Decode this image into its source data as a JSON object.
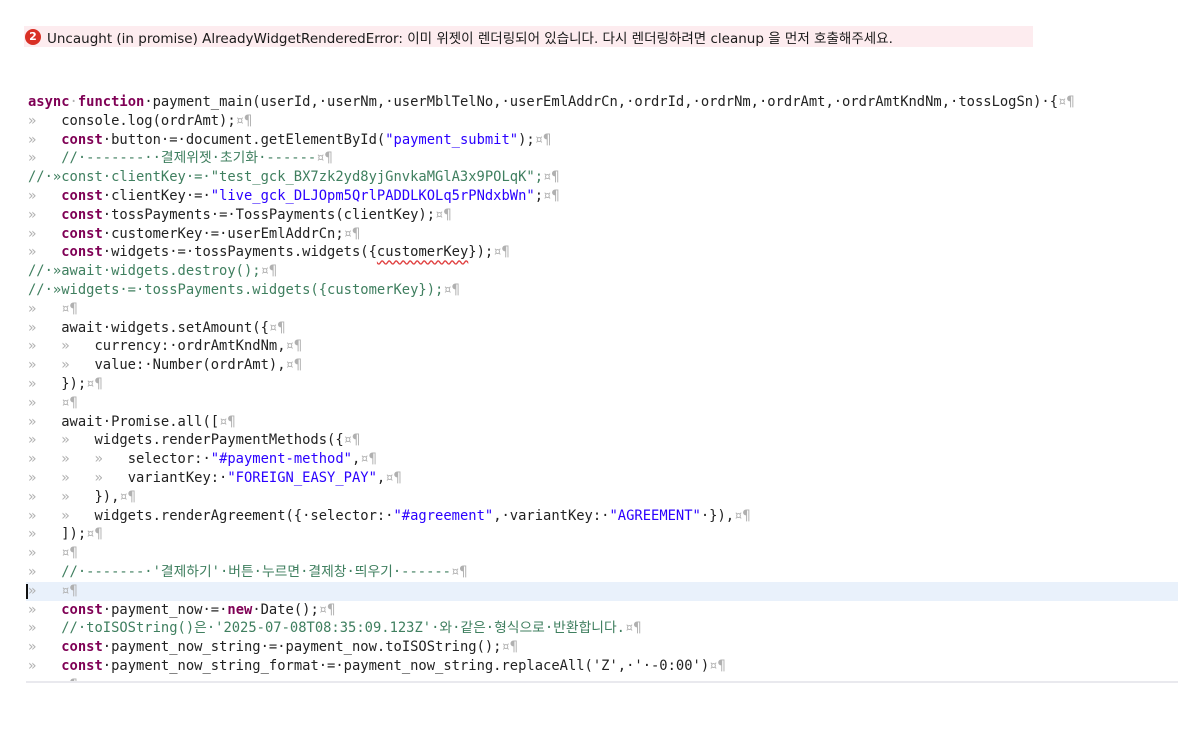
{
  "error_banner": {
    "icon_text": "2",
    "message": "Uncaught (in promise) AlreadyWidgetRenderedError: 이미 위젯이 렌더링되어 있습니다. 다시 렌더링하려면 cleanup 을 먼저 호출해주세요."
  },
  "editor": {
    "highlighted_line": 27,
    "lines": [
      [
        {
          "t": "async",
          "c": "kw"
        },
        {
          "t": "·",
          "c": "ws"
        },
        {
          "t": "function",
          "c": "kw"
        },
        {
          "t": "·payment_main(userId,·userNm,·userMblTelNo,·userEmlAddrCn,·ordrId,·ordrNm,·ordrAmt,·ordrAmtKndNm,·tossLogSn)·{"
        },
        {
          "t": "¤¶",
          "c": "ws"
        }
      ],
      [
        {
          "t": "»   ",
          "c": "ws"
        },
        {
          "t": "console.log(ordrAmt);"
        },
        {
          "t": "¤¶",
          "c": "ws"
        }
      ],
      [
        {
          "t": "»   ",
          "c": "ws"
        },
        {
          "t": "const",
          "c": "kw"
        },
        {
          "t": "·button·=·document.getElementById("
        },
        {
          "t": "\"payment_submit\"",
          "c": "str"
        },
        {
          "t": ");"
        },
        {
          "t": "¤¶",
          "c": "ws"
        }
      ],
      [
        {
          "t": "»   ",
          "c": "ws"
        },
        {
          "t": "//·-------··결제위젯·초기화·------",
          "c": "cm"
        },
        {
          "t": "¤¶",
          "c": "ws"
        }
      ],
      [
        {
          "t": "//·»const·clientKey·=·\"test_gck_BX7zk2yd8yjGnvkaMGlA3x9POLqK\";",
          "c": "cm"
        },
        {
          "t": "¤¶",
          "c": "ws"
        }
      ],
      [
        {
          "t": "»   ",
          "c": "ws"
        },
        {
          "t": "const",
          "c": "kw"
        },
        {
          "t": "·clientKey·=·"
        },
        {
          "t": "\"live_gck_DLJOpm5QrlPADDLKOLq5rPNdxbWn\"",
          "c": "str"
        },
        {
          "t": ";"
        },
        {
          "t": "¤¶",
          "c": "ws"
        }
      ],
      [
        {
          "t": "»   ",
          "c": "ws"
        },
        {
          "t": "const",
          "c": "kw"
        },
        {
          "t": "·tossPayments·=·TossPayments(clientKey);"
        },
        {
          "t": "¤¶",
          "c": "ws"
        }
      ],
      [
        {
          "t": "»   ",
          "c": "ws"
        },
        {
          "t": "const",
          "c": "kw"
        },
        {
          "t": "·customerKey·=·userEmlAddrCn;"
        },
        {
          "t": "¤¶",
          "c": "ws"
        }
      ],
      [
        {
          "t": "»   ",
          "c": "ws"
        },
        {
          "t": "const",
          "c": "kw"
        },
        {
          "t": "·widgets·=·tossPayments.widgets({"
        },
        {
          "t": "customerKey",
          "c": "u"
        },
        {
          "t": "});"
        },
        {
          "t": "¤¶",
          "c": "ws"
        }
      ],
      [
        {
          "t": "//·»await·widgets.destroy();",
          "c": "cm"
        },
        {
          "t": "¤¶",
          "c": "ws"
        }
      ],
      [
        {
          "t": "//·»widgets·=·tossPayments.widgets({customerKey});",
          "c": "cm"
        },
        {
          "t": "¤¶",
          "c": "ws"
        }
      ],
      [
        {
          "t": "»   ¤¶",
          "c": "ws"
        }
      ],
      [
        {
          "t": "»   ",
          "c": "ws"
        },
        {
          "t": "await·widgets.setAmount({"
        },
        {
          "t": "¤¶",
          "c": "ws"
        }
      ],
      [
        {
          "t": "»   »   ",
          "c": "ws"
        },
        {
          "t": "currency:·ordrAmtKndNm,"
        },
        {
          "t": "¤¶",
          "c": "ws"
        }
      ],
      [
        {
          "t": "»   »   ",
          "c": "ws"
        },
        {
          "t": "value:·Number(ordrAmt),"
        },
        {
          "t": "¤¶",
          "c": "ws"
        }
      ],
      [
        {
          "t": "»   ",
          "c": "ws"
        },
        {
          "t": "});"
        },
        {
          "t": "¤¶",
          "c": "ws"
        }
      ],
      [
        {
          "t": "»   ¤¶",
          "c": "ws"
        }
      ],
      [
        {
          "t": "»   ",
          "c": "ws"
        },
        {
          "t": "await·Promise.all(["
        },
        {
          "t": "¤¶",
          "c": "ws"
        }
      ],
      [
        {
          "t": "»   »   ",
          "c": "ws"
        },
        {
          "t": "widgets.renderPaymentMethods({"
        },
        {
          "t": "¤¶",
          "c": "ws"
        }
      ],
      [
        {
          "t": "»   »   »   ",
          "c": "ws"
        },
        {
          "t": "selector:·"
        },
        {
          "t": "\"#payment-method\"",
          "c": "str"
        },
        {
          "t": ","
        },
        {
          "t": "¤¶",
          "c": "ws"
        }
      ],
      [
        {
          "t": "»   »   »   ",
          "c": "ws"
        },
        {
          "t": "variantKey:·"
        },
        {
          "t": "\"FOREIGN_EASY_PAY\"",
          "c": "str"
        },
        {
          "t": ","
        },
        {
          "t": "¤¶",
          "c": "ws"
        }
      ],
      [
        {
          "t": "»   »   ",
          "c": "ws"
        },
        {
          "t": "}),"
        },
        {
          "t": "¤¶",
          "c": "ws"
        }
      ],
      [
        {
          "t": "»   »   ",
          "c": "ws"
        },
        {
          "t": "widgets.renderAgreement({·selector:·"
        },
        {
          "t": "\"#agreement\"",
          "c": "str"
        },
        {
          "t": ",·variantKey:·"
        },
        {
          "t": "\"AGREEMENT\"",
          "c": "str"
        },
        {
          "t": "·}),"
        },
        {
          "t": "¤¶",
          "c": "ws"
        }
      ],
      [
        {
          "t": "»   ",
          "c": "ws"
        },
        {
          "t": "]);"
        },
        {
          "t": "¤¶",
          "c": "ws"
        }
      ],
      [
        {
          "t": "»   ¤¶",
          "c": "ws"
        }
      ],
      [
        {
          "t": "»   ",
          "c": "ws"
        },
        {
          "t": "//·-------·'결제하기'·버튼·누르면·결제창·띄우기·------",
          "c": "cm"
        },
        {
          "t": "¤¶",
          "c": "ws"
        }
      ],
      [
        {
          "t": "»   ¤¶",
          "c": "ws"
        }
      ],
      [
        {
          "t": "»   ",
          "c": "ws"
        },
        {
          "t": "const",
          "c": "kw"
        },
        {
          "t": "·payment_now·=·"
        },
        {
          "t": "new",
          "c": "kw"
        },
        {
          "t": "·Date();"
        },
        {
          "t": "¤¶",
          "c": "ws"
        }
      ],
      [
        {
          "t": "»   ",
          "c": "ws"
        },
        {
          "t": "//·toISOString()은·'2025-07-08T08:35:09.123Z'·와·같은·형식으로·반환합니다.",
          "c": "cm"
        },
        {
          "t": "¤¶",
          "c": "ws"
        }
      ],
      [
        {
          "t": "»   ",
          "c": "ws"
        },
        {
          "t": "const",
          "c": "kw"
        },
        {
          "t": "·payment_now_string·=·payment_now.toISOString();"
        },
        {
          "t": "¤¶",
          "c": "ws"
        }
      ],
      [
        {
          "t": "»   ",
          "c": "ws"
        },
        {
          "t": "const",
          "c": "kw"
        },
        {
          "t": "·payment_now_string_format·=·payment_now_string.replaceAll('Z',·'·-0:00')"
        },
        {
          "t": "¤¶",
          "c": "ws"
        }
      ],
      [
        {
          "t": "»   ¤¶",
          "c": "ws"
        }
      ]
    ]
  }
}
